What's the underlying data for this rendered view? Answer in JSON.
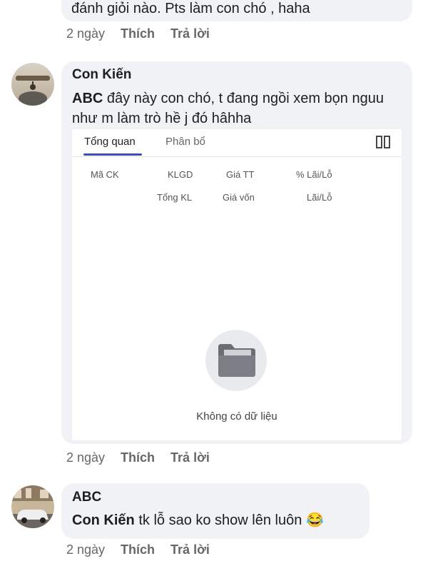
{
  "top_comment": {
    "text": "đánh giỏi nào. Pts làm con chó , haha",
    "time": "2 ngày",
    "like": "Thích",
    "reply": "Trả lời"
  },
  "comment2": {
    "author": "Con Kiến",
    "mention": "ABC",
    "text": " đây này con chó, t đang ngồi xem bọn nguu như m làm trò hề j đó hâhha",
    "time": "2 ngày",
    "like": "Thích",
    "reply": "Trả lời",
    "attachment": {
      "tabs": [
        "Tổng quan",
        "Phân bổ"
      ],
      "active_tab": "Tổng quan",
      "columns_row1": [
        "Mã CK",
        "KLGD",
        "Giá TT",
        "% Lãi/Lỗ"
      ],
      "columns_row2": [
        "Tổng KL",
        "Giá vốn",
        "Lãi/Lỗ"
      ],
      "empty_text": "Không có dữ liệu",
      "icons": [
        "columns-toggle-icon",
        "folder-icon"
      ],
      "accent_color": "#3a4dbd"
    }
  },
  "comment3": {
    "author": "ABC",
    "mention": "Con Kiến",
    "text": " tk lỗ sao ko show lên luôn",
    "emoji": "😂",
    "time": "2 ngày",
    "like": "Thích",
    "reply": "Trả lời"
  }
}
